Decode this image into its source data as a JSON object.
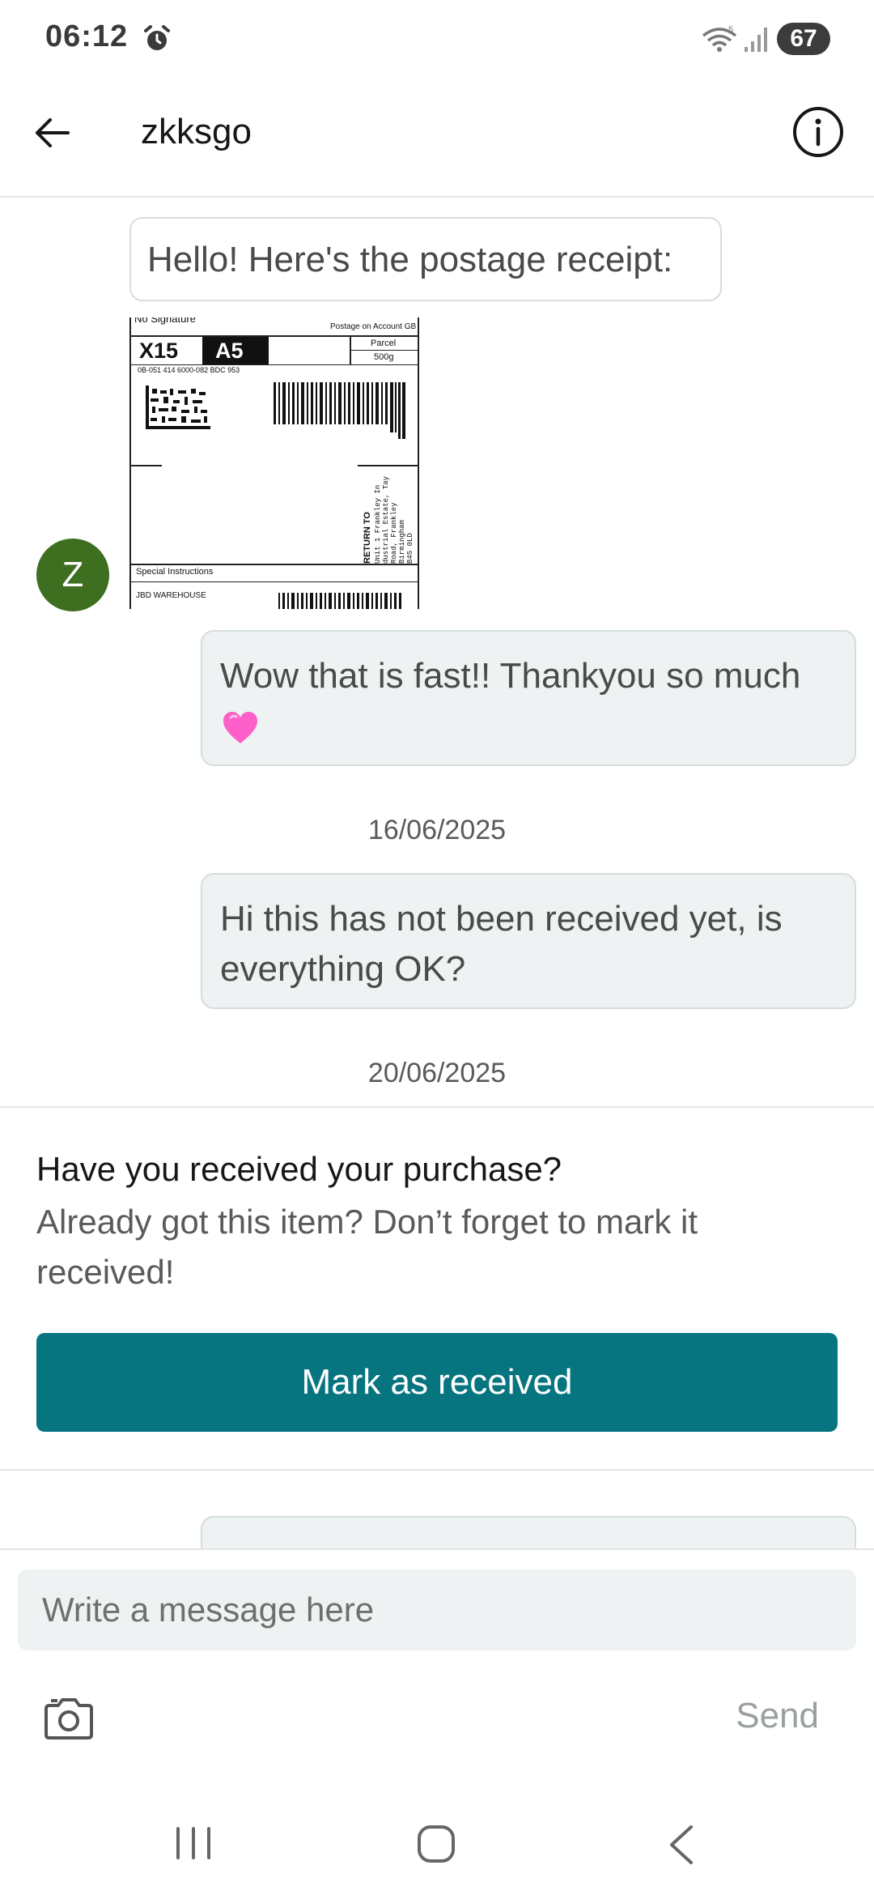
{
  "status_bar": {
    "time": "06:12",
    "battery": "67",
    "icons": [
      "alarm-icon",
      "wifi-icon",
      "signal-icon"
    ]
  },
  "header": {
    "title": "zkksgo",
    "icons": [
      "back-arrow-icon",
      "info-icon"
    ]
  },
  "messages": [
    {
      "text": "Hello! Here's the postage receipt:",
      "direction": "incoming"
    },
    {
      "text": "Wow that is fast!! Thankyou so much",
      "direction": "outgoing",
      "emoji": "heart-icon"
    },
    {
      "text": "Hi this has not been received yet, is everything OK?",
      "direction": "outgoing"
    }
  ],
  "dates": [
    "16/06/2025",
    "20/06/2025"
  ],
  "avatar_initial": "Z",
  "postage_label": {
    "top_line": "No Signature",
    "account": "Postage on Account GB",
    "service": "X15",
    "size": "A5",
    "type": "Parcel",
    "weight": "500g",
    "ref": "0B-051 414 6000-082 BDC 953",
    "return_to": "RETURN TO",
    "return_address": [
      "Unit 1 Frankley In",
      "dustrial Estate, Tay",
      "Road, Frankley",
      "Birmingham",
      "B45 0LD"
    ],
    "special": "Special Instructions",
    "sender": "JBD WAREHOUSE"
  },
  "prompt": {
    "title": "Have you received your purchase?",
    "text": "Already got this item? Don’t forget to mark it received!",
    "button": "Mark as received"
  },
  "compose": {
    "placeholder": "Write a message here",
    "send": "Send"
  },
  "colors": {
    "accent": "#077580",
    "avatar": "#3e6e1f",
    "bubble_outgoing": "#eef2f2",
    "bubble_border": "#d6dddd"
  }
}
